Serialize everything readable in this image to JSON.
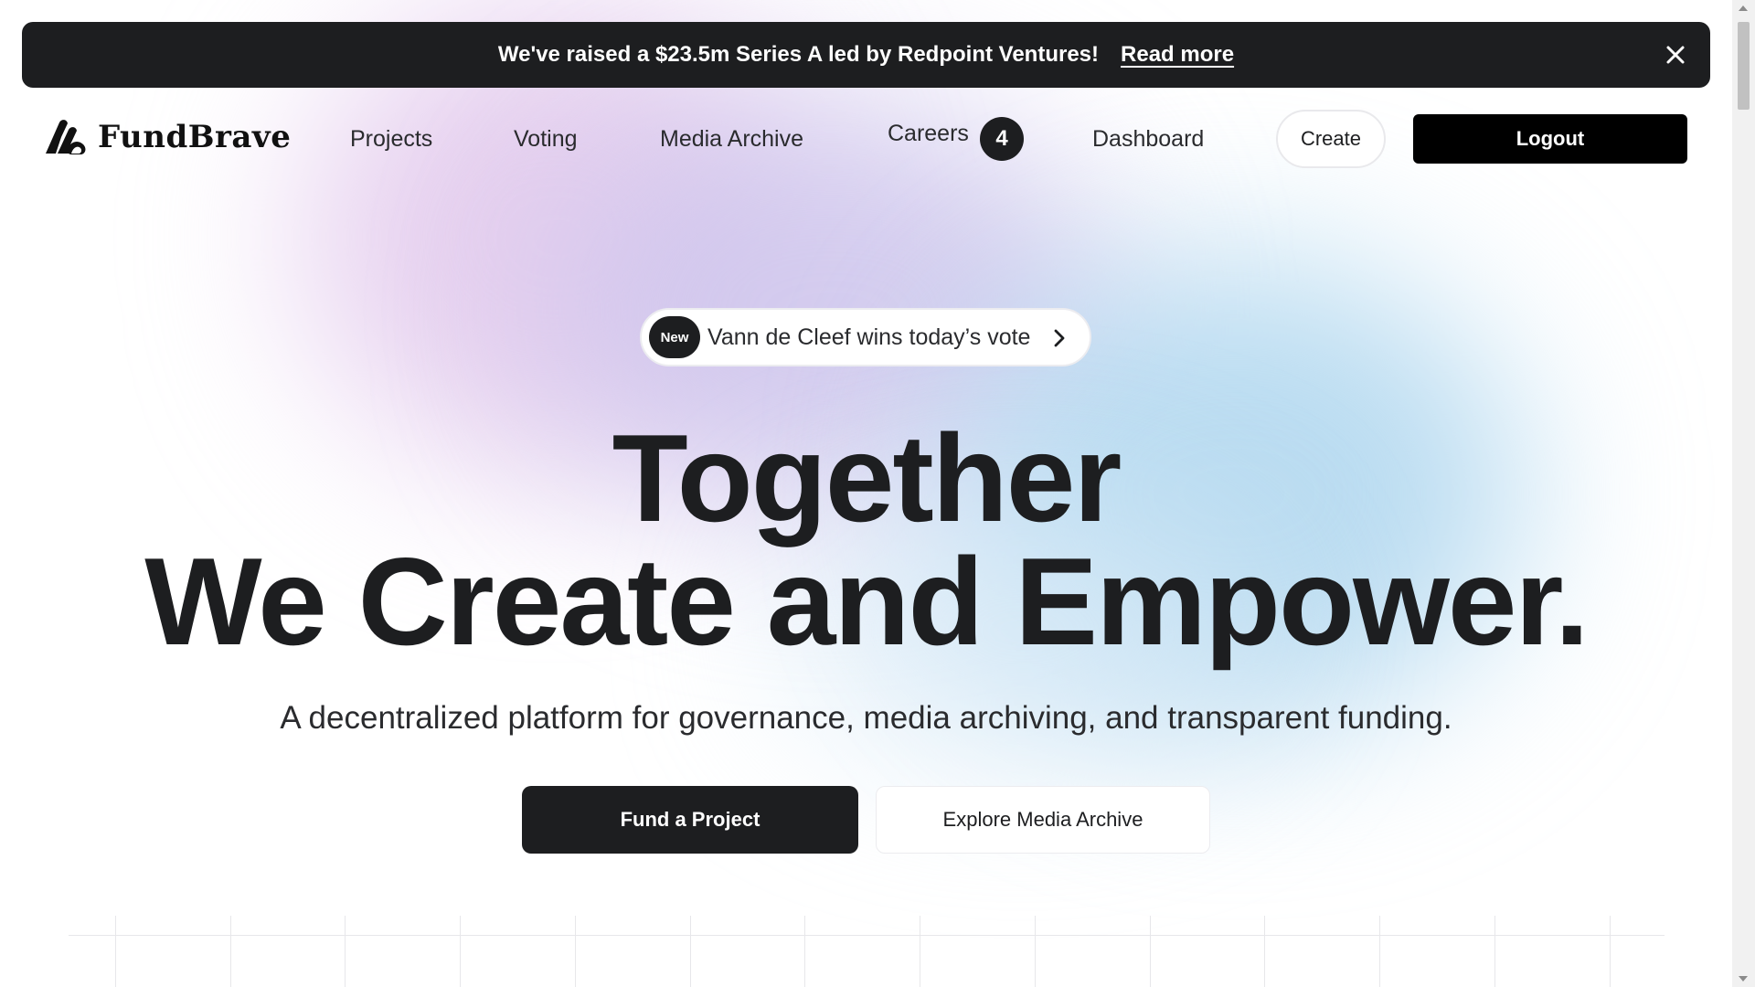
{
  "announcement": {
    "text": "We've raised a $23.5m Series A led by Redpoint Ventures!",
    "link_label": "Read more",
    "close_icon": "close-icon"
  },
  "nav": {
    "brand": "FundBrave",
    "logo_icon": "fundbrave-logo-icon",
    "links": {
      "projects": "Projects",
      "voting": "Voting",
      "media_archive": "Media Archive",
      "careers": "Careers",
      "dashboard": "Dashboard"
    },
    "careers_badge": "4",
    "create_label": "Create",
    "logout_label": "Logout"
  },
  "hero": {
    "pill": {
      "badge": "New",
      "text": "Vann de Cleef wins today’s vote",
      "icon": "chevron-right-icon"
    },
    "headline_line1": "Together",
    "headline_line2": "We Create and Empower.",
    "subtitle": "A decentralized platform for governance, media archiving, and transparent funding.",
    "primary_cta": "Fund a Project",
    "secondary_cta": "Explore Media Archive"
  },
  "colors": {
    "dark": "#1d1e20",
    "accent_pink": "#e2c8ec",
    "accent_lavender": "#cec6ec",
    "accent_blue": "#b2d8f0"
  }
}
